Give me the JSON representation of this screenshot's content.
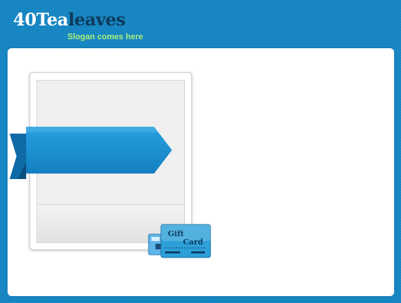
{
  "header": {
    "logo_part1": "40Tea",
    "logo_part2": "leaves",
    "slogan": "Slogan comes here"
  },
  "gift_card": {
    "line1": "Gift",
    "line2": "Card"
  },
  "colors": {
    "background": "#1585c2",
    "ribbon": "#1a8fd4",
    "logo_dark": "#0e3a5c",
    "slogan": "#a8f07a"
  }
}
